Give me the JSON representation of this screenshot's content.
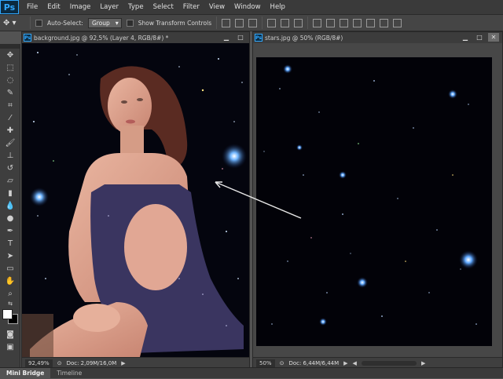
{
  "app": {
    "logo": "Ps"
  },
  "menubar": {
    "items": [
      "File",
      "Edit",
      "Image",
      "Layer",
      "Type",
      "Select",
      "Filter",
      "View",
      "Window",
      "Help"
    ]
  },
  "options": {
    "auto_select_label": "Auto-Select:",
    "auto_select_value": "Group",
    "transform_label": "Show Transform Controls"
  },
  "documents": [
    {
      "title": "background.jpg @ 92,5% (Layer 4, RGB/8#) *",
      "zoom": "92,49%",
      "doc_info": "Doc: 2,09M/16,0M"
    },
    {
      "title": "stars.jpg @ 50% (RGB/8#)",
      "zoom": "50%",
      "doc_info": "Doc: 6,44M/6,44M"
    }
  ],
  "bottom_tabs": [
    "Mini Bridge",
    "Timeline"
  ],
  "colors": {
    "accent": "#31a8ff",
    "bg": "#535353",
    "canvas": "#050510"
  }
}
